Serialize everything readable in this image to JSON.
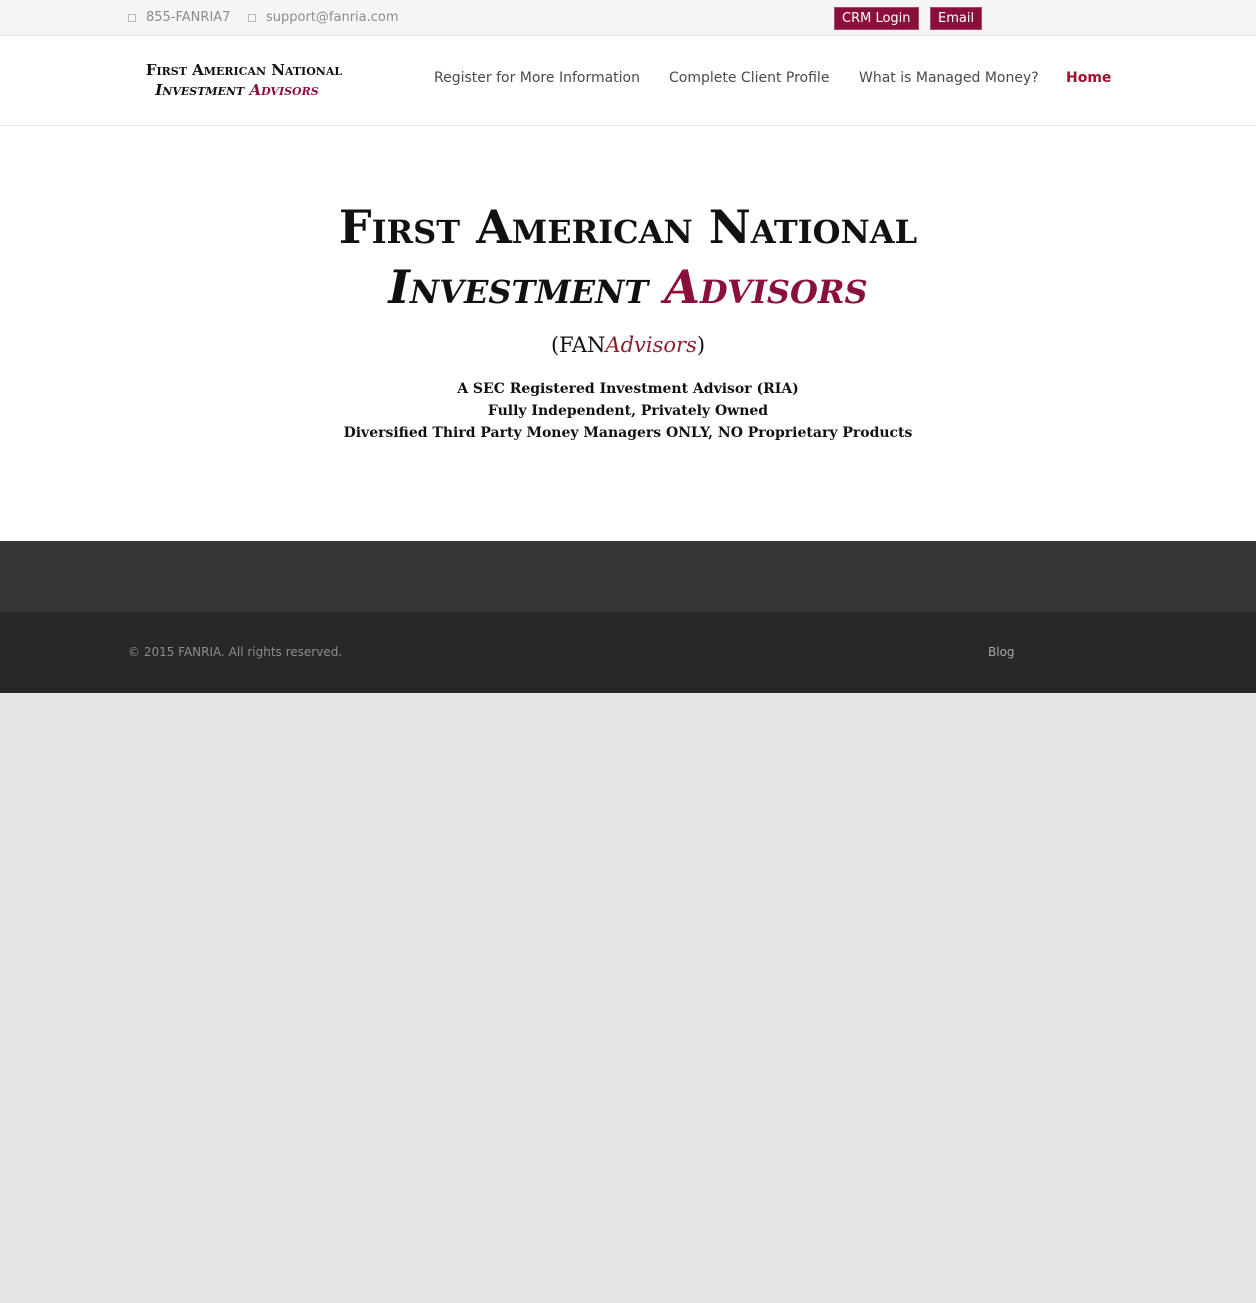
{
  "topbar": {
    "phone": "855-FANRIA7",
    "email": "support@fanria.com",
    "crm_login": "CRM Login",
    "email_button": "Email"
  },
  "logo": {
    "line1": "First American National",
    "line2_word1": "Investment",
    "line2_word2": "Advisors"
  },
  "nav": [
    {
      "label": "Register for More Information"
    },
    {
      "label": "Complete Client Profile"
    },
    {
      "label": "What is Managed Money?"
    },
    {
      "label": "Home",
      "active": true
    }
  ],
  "hero": {
    "line1": "First American National",
    "line2_word1": "Investment",
    "line2_word2": "Advisors",
    "abbr_open": "(FAN",
    "abbr_italic": "Advisors",
    "abbr_close": ")",
    "taglines": [
      "A SEC Registered Investment Advisor (RIA)",
      "Fully Independent, Privately Owned",
      "Diversified Third Party Money Managers ONLY, NO Proprietary Products"
    ]
  },
  "footer": {
    "copyright": "© 2015 FANRIA. All rights reserved.",
    "link": "Blog"
  },
  "colors": {
    "brand": "#8b0f3d",
    "active_nav": "#a0102c",
    "footer_widgets": "#363636",
    "footer": "#282828",
    "page_bg": "#e5e5e5"
  }
}
